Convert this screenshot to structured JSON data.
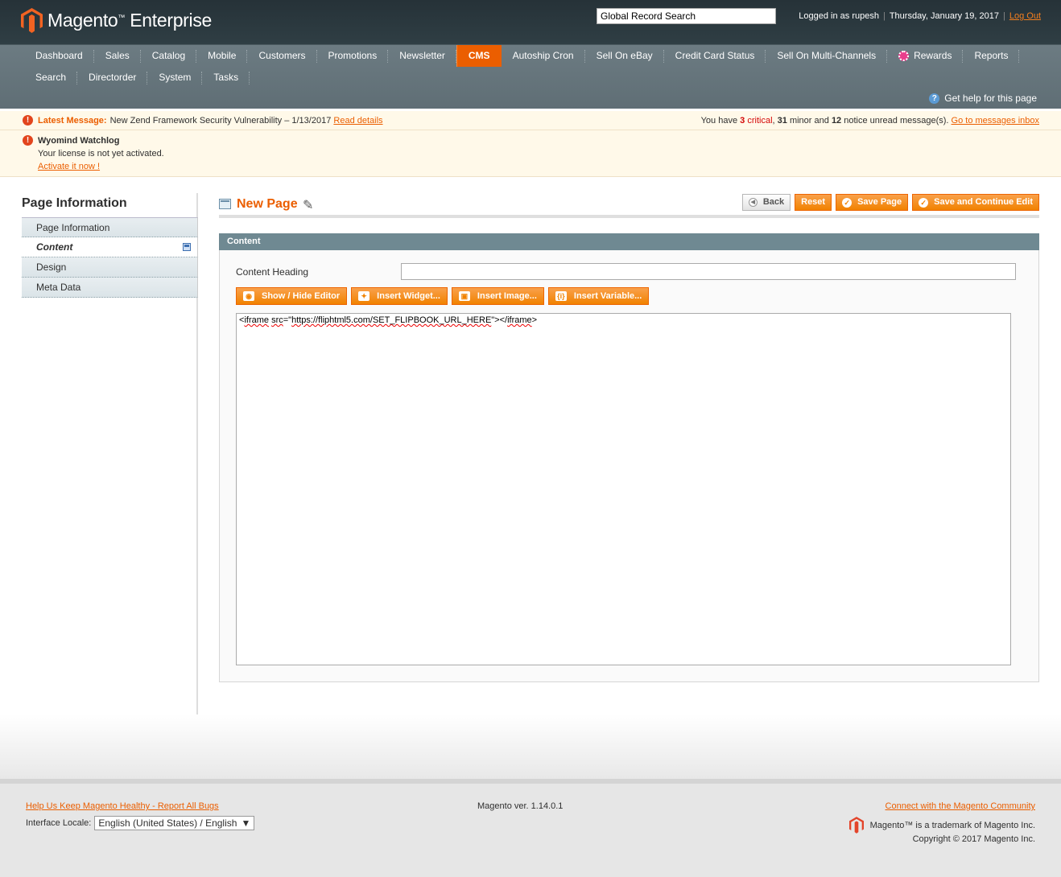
{
  "header": {
    "brand": "Magento",
    "brand_sub": "Enterprise",
    "search_value": "Global Record Search",
    "logged_in": "Logged in as rupesh",
    "date": "Thursday, January 19, 2017",
    "logout": "Log Out"
  },
  "nav": {
    "row1": [
      "Dashboard",
      "Sales",
      "Catalog",
      "Mobile",
      "Customers",
      "Promotions",
      "Newsletter",
      "CMS",
      "Autoship Cron",
      "Sell On eBay",
      "Credit Card Status",
      "Sell On Multi-Channels",
      "Rewards",
      "Reports"
    ],
    "row2": [
      "Search",
      "Directorder",
      "System",
      "Tasks"
    ],
    "active": "CMS",
    "help": "Get help for this page"
  },
  "notice": {
    "latest_label": "Latest Message:",
    "latest_text": "New Zend Framework Security Vulnerability – 1/13/2017",
    "read_details": "Read details",
    "summary_prefix": "You have",
    "critical_count": "3",
    "critical_label": "critical",
    "minor_count": "31",
    "minor_label": "minor and",
    "notice_count": "12",
    "notice_label": "notice unread message(s).",
    "inbox_link": "Go to messages inbox"
  },
  "watchlog": {
    "title": "Wyomind Watchlog",
    "text": "Your license is not yet activated.",
    "link": "Activate it now !"
  },
  "sidebar": {
    "title": "Page Information",
    "tabs": [
      "Page Information",
      "Content",
      "Design",
      "Meta Data"
    ],
    "active_tab": "Content"
  },
  "page": {
    "title": "New Page",
    "buttons": {
      "back": "Back",
      "reset": "Reset",
      "save": "Save Page",
      "save_continue": "Save and Continue Edit"
    }
  },
  "content": {
    "section_title": "Content",
    "heading_label": "Content Heading",
    "heading_value": "",
    "editor_buttons": [
      "Show / Hide Editor",
      "Insert Widget...",
      "Insert Image...",
      "Insert Variable..."
    ],
    "textarea_parts": [
      "<",
      "iframe",
      " ",
      "src",
      "=\"",
      "https://fliphtml5.com/SET_FLIPBOOK_URL_HERE",
      "\"></",
      "iframe",
      ">"
    ]
  },
  "footer": {
    "help_link": "Help Us Keep Magento Healthy - Report All Bugs",
    "locale_label": "Interface Locale:",
    "locale_value": "English (United States) / English",
    "version": "Magento ver. 1.14.0.1",
    "community_link": "Connect with the Magento Community",
    "trademark": "Magento™ is a trademark of Magento Inc.",
    "copyright": "Copyright © 2017 Magento Inc."
  },
  "colors": {
    "accent": "#eb5e00",
    "nav_bg": "#6c7b82",
    "header_bg": "#263238",
    "fieldset_head": "#6f8992"
  }
}
